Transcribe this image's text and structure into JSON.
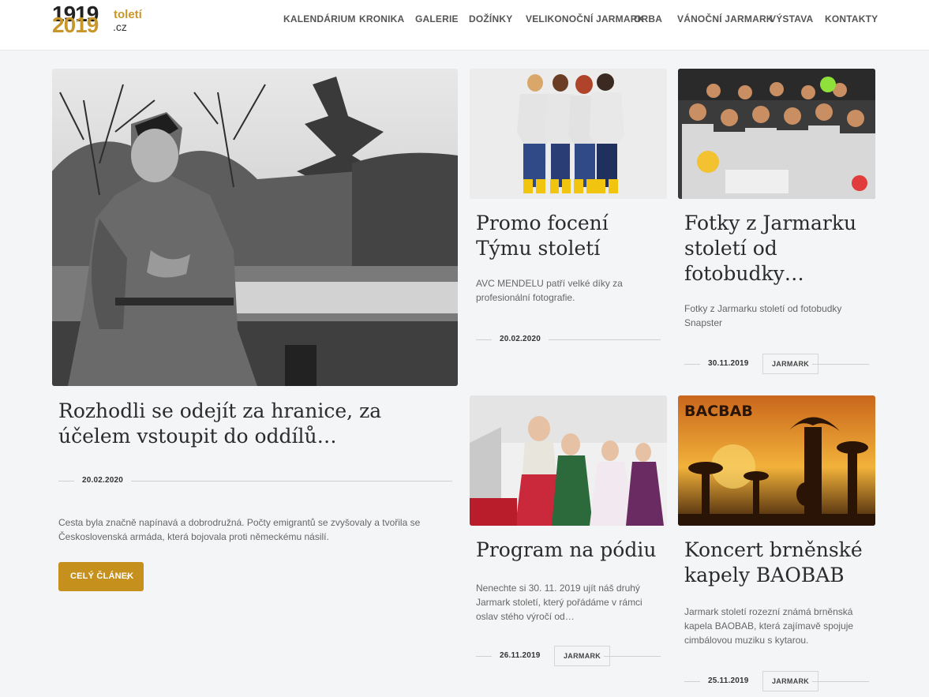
{
  "logo": {
    "year_old": "1919",
    "year_new": "2019",
    "word": "toletí",
    "tld": ".cz"
  },
  "nav": [
    "KALENDÁRIUM",
    "KRONIKA",
    "GALERIE",
    "DOŽÍNKY",
    "VELIKONOČNÍ JARMARK",
    "ORBA",
    "VÁNOČNÍ JARMARK",
    "VÝSTAVA",
    "KONTAKTY"
  ],
  "featured": {
    "title": "Rozhodli se odejít za hranice, za účelem vstoupit do oddílů…",
    "date": "20.02.2020",
    "excerpt": "Cesta byla značně napínavá a dobrodružná. Počty emigrantů se zvyšovaly a tvořila se Československá armáda, která bojovala proti německému násilí.",
    "button": "CELÝ ČLÁNEK",
    "button_icon": "chevron-right-icon"
  },
  "posts": [
    {
      "title": "Promo focení Týmu století",
      "excerpt": "AVC MENDELU patří velké díky za profesionální fotografie.",
      "date": "20.02.2020",
      "tag": ""
    },
    {
      "title": "Fotky z Jarmarku století od fotobudky…",
      "excerpt": "Fotky z Jarmarku století od fotobudky Snapster",
      "date": "30.11.2019",
      "tag": "JARMARK"
    },
    {
      "title": "Program na pódiu",
      "excerpt": "Nenechte si 30. 11. 2019 ujít náš druhý Jarmark století, který pořádáme v rámci oslav stého výročí od…",
      "date": "26.11.2019",
      "tag": "JARMARK"
    },
    {
      "title": "Koncert brněnské kapely BAOBAB",
      "excerpt": "Jarmark století rozezní známá brněnská kapela BAOBAB, která zajímavě spojuje cimbálovou muziku s kytarou.",
      "date": "25.11.2019",
      "tag": "JARMARK"
    }
  ],
  "image_text": {
    "baobab_band": "BACBAB"
  },
  "colors": {
    "accent": "#c6901c",
    "background": "#f4f5f6"
  }
}
